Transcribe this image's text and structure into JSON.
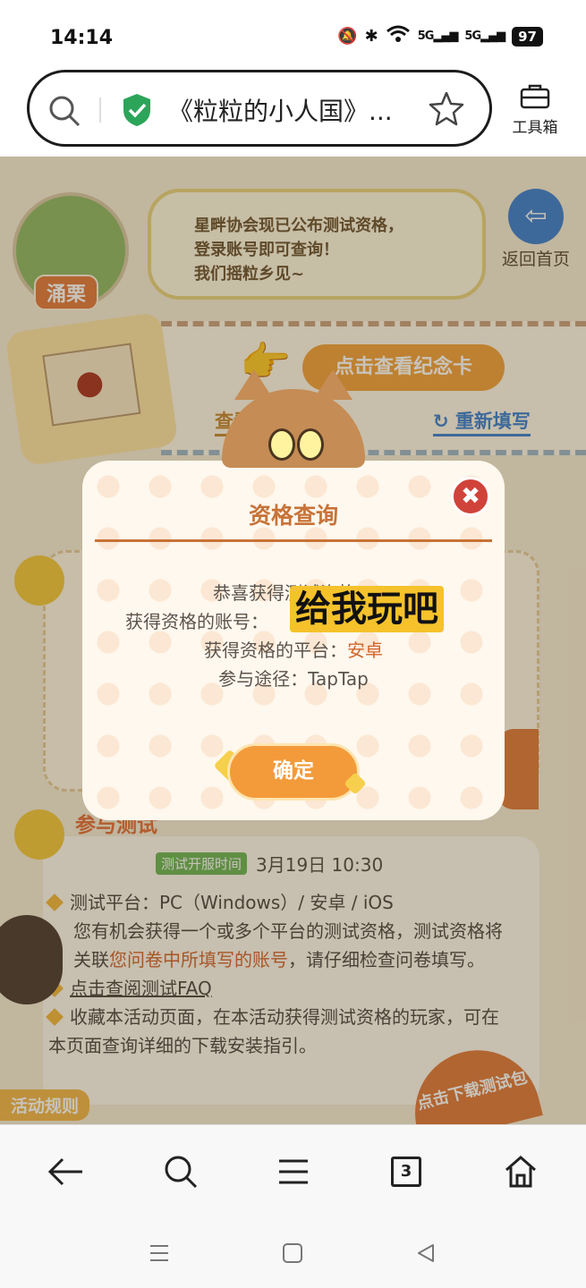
{
  "status_bar": {
    "time": "14:14",
    "signal_1": "5G",
    "signal_2": "5G",
    "battery": "97"
  },
  "browser": {
    "url_title": "《粒粒的小人国》...",
    "toolbox_label": "工具箱",
    "tab_count": "3"
  },
  "page": {
    "character_name": "涌栗",
    "bubble_lines": [
      "星畔协会现已公布测试资格，",
      "登录账号即可查询！",
      "我们摇粒乡见~"
    ],
    "home_label": "返回首页",
    "view_card_label": "点击查看纪念卡",
    "view_record_label": "查看填写记录",
    "refill_label": "重新填写",
    "join_title": "参与测试",
    "test_time_badge": "测试开服时间",
    "test_time_value": "3月19日 10:30",
    "rules": {
      "platform_line": "测试平台：PC（Windows）/ 安卓 / iOS",
      "qualification_text_1": "您有机会获得一个或多个平台的测试资格，测试资格将关联",
      "qualification_highlight": "您问卷中所填写的账号",
      "qualification_text_2": "，请仔细检查问卷填写。",
      "faq_link": "点击查阅测试FAQ",
      "collect_line": "收藏本活动页面，在本活动获得测试资格的玩家，可在本页面查询详细的下载安装指引。"
    },
    "rules_tab": "活动规则",
    "download_label": "点击下载测试包"
  },
  "dialog": {
    "title": "资格查询",
    "congrats": "恭喜获得测试资格！",
    "account_label": "获得资格的账号：",
    "platform_label": "获得资格的平台：",
    "platform_value": "安卓",
    "channel_line": "参与途径：TapTap",
    "confirm_label": "确定",
    "close_symbol": "✖"
  },
  "overlay": {
    "caption": "给我玩吧"
  },
  "colors": {
    "accent_orange": "#e26e37",
    "shield_green": "#2ca55a",
    "home_blue": "#3a7fd0"
  }
}
